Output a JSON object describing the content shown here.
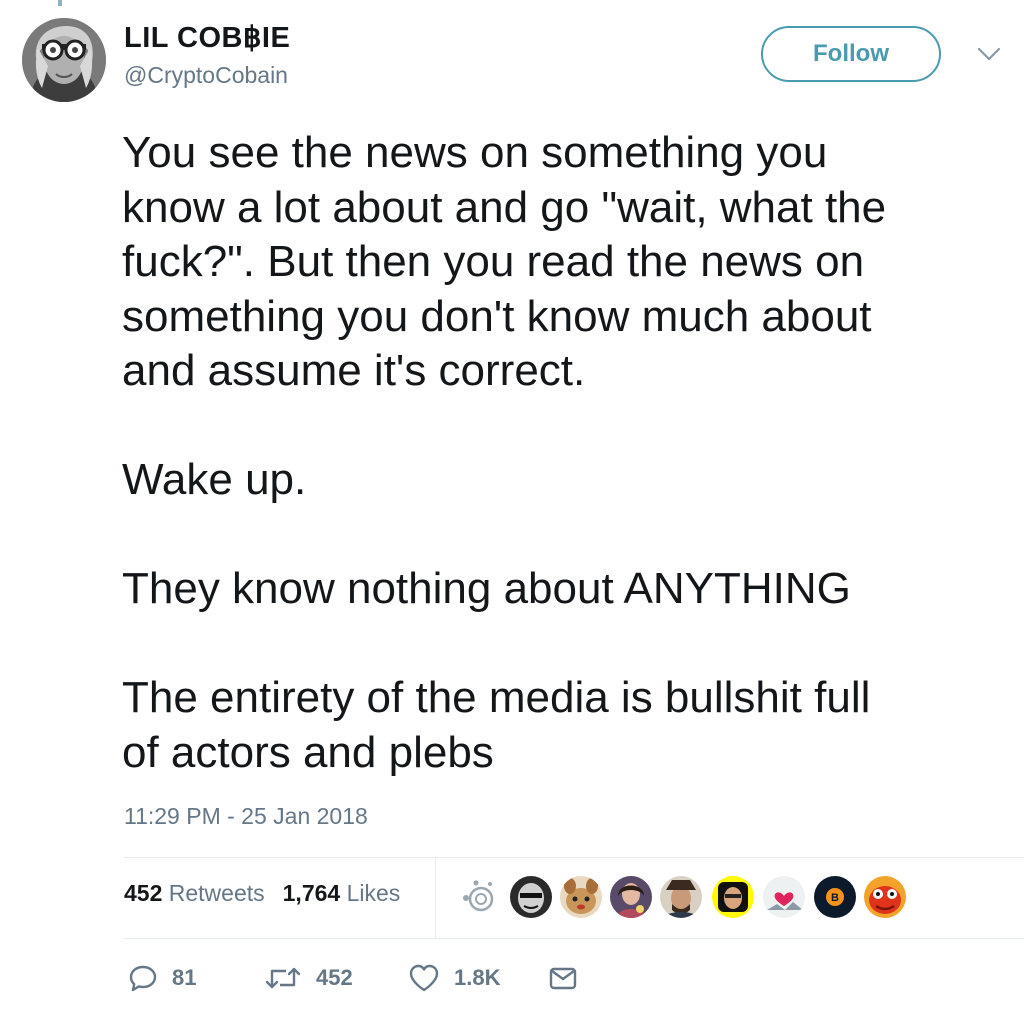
{
  "user": {
    "display_name": "LIL COB฿IE",
    "handle": "@CryptoCobain"
  },
  "follow_label": "Follow",
  "tweet_text": "You see the news on something you\nknow a lot about and go \"wait, what the\nfuck?\". But then you read the news on\nsomething you don't know much about\nand assume it's correct.\n\nWake up.\n\nThey know nothing about ANYTHING\n\nThe entirety of the media is bullshit full\nof actors and plebs",
  "timestamp": "11:29 PM - 25 Jan 2018",
  "stats": {
    "retweets_count": "452",
    "retweets_label": "Retweets",
    "likes_count": "1,764",
    "likes_label": "Likes"
  },
  "liker_avatars": [
    "verified-ring-icon",
    "avatar-bw-face",
    "avatar-animal",
    "avatar-woman",
    "avatar-man-hat",
    "avatar-snapchat",
    "avatar-heart",
    "avatar-bitcoin",
    "avatar-red"
  ],
  "actions": {
    "reply_count": "81",
    "retweet_count": "452",
    "like_count": "1.8K"
  },
  "colors": {
    "accent": "#4a9ab0",
    "text": "#14171a",
    "muted": "#657786",
    "divider": "#e6ecf0"
  }
}
